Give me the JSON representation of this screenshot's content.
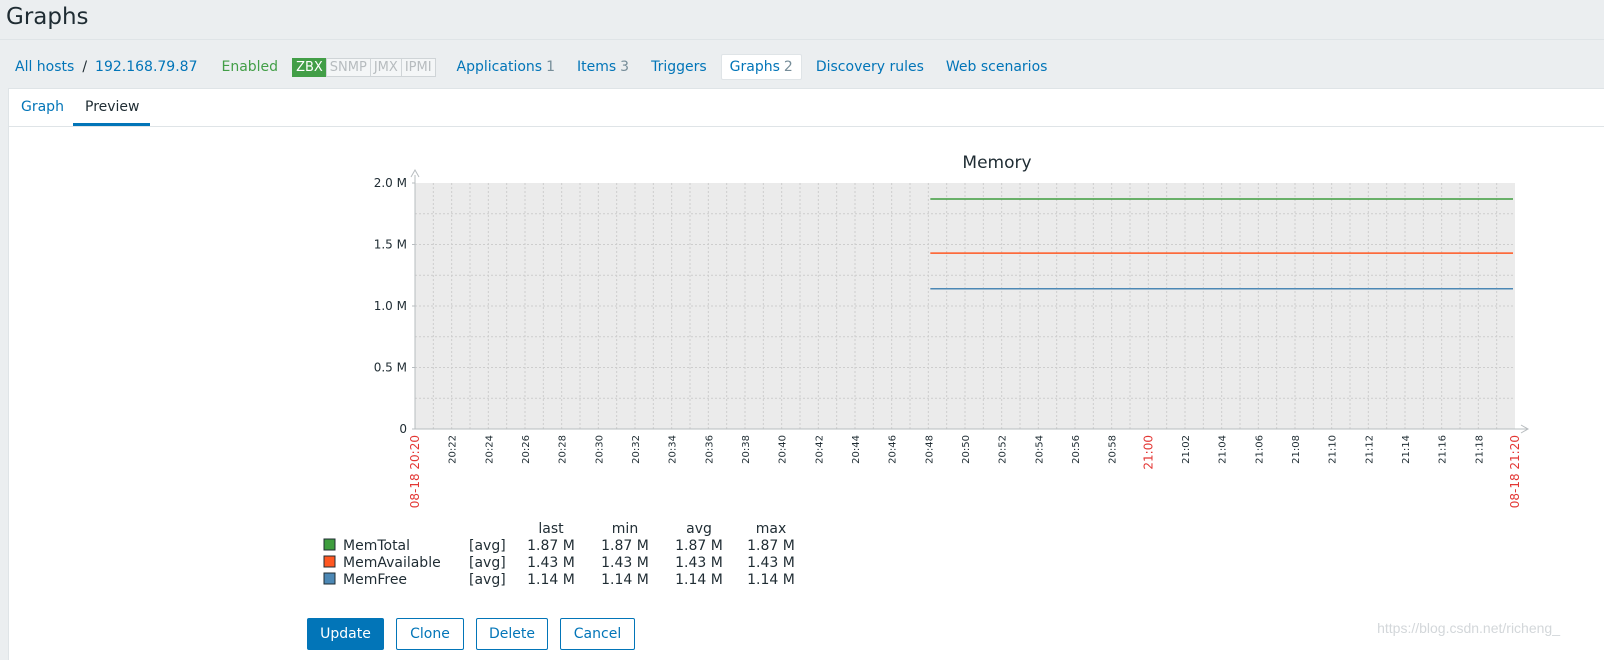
{
  "page": {
    "title": "Graphs"
  },
  "hostnav": {
    "all_hosts": "All hosts",
    "separator": "/",
    "host": "192.168.79.87",
    "status": "Enabled",
    "badges": [
      "ZBX",
      "SNMP",
      "JMX",
      "IPMI"
    ],
    "menu": [
      {
        "label": "Applications",
        "count": "1"
      },
      {
        "label": "Items",
        "count": "3"
      },
      {
        "label": "Triggers",
        "count": ""
      },
      {
        "label": "Graphs",
        "count": "2"
      },
      {
        "label": "Discovery rules",
        "count": ""
      },
      {
        "label": "Web scenarios",
        "count": ""
      }
    ]
  },
  "tabs": [
    "Graph",
    "Preview"
  ],
  "chart_data": {
    "type": "line",
    "title": "Memory",
    "x": [
      "20:20",
      "20:22",
      "20:24",
      "20:26",
      "20:28",
      "20:30",
      "20:32",
      "20:34",
      "20:36",
      "20:38",
      "20:40",
      "20:42",
      "20:44",
      "20:46",
      "20:48",
      "20:50",
      "20:52",
      "20:54",
      "20:56",
      "20:58",
      "21:00",
      "21:02",
      "21:04",
      "21:06",
      "21:08",
      "21:10",
      "21:12",
      "21:14",
      "21:16",
      "21:18",
      "21:20"
    ],
    "x_edge_labels": [
      "08-18 20:20",
      "08-18 21:20"
    ],
    "x_highlight": "21:00",
    "y_ticks": [
      "0",
      "0.5 M",
      "1.0 M",
      "1.5 M",
      "2.0 M"
    ],
    "ylim": [
      0,
      2.0
    ],
    "grid": true,
    "legend_headers": [
      "last",
      "min",
      "avg",
      "max"
    ],
    "series": [
      {
        "name": "MemTotal",
        "func": "[avg]",
        "color": "#3e9d3e",
        "start": "20:48",
        "end": "21:20",
        "value": 1.87,
        "last": "1.87 M",
        "min": "1.87 M",
        "avg": "1.87 M",
        "max": "1.87 M"
      },
      {
        "name": "MemAvailable",
        "func": "[avg]",
        "color": "#ff5722",
        "start": "20:48",
        "end": "21:20",
        "value": 1.43,
        "last": "1.43 M",
        "min": "1.43 M",
        "avg": "1.43 M",
        "max": "1.43 M"
      },
      {
        "name": "MemFree",
        "func": "[avg]",
        "color": "#4c88b5",
        "start": "20:48",
        "end": "21:20",
        "value": 1.14,
        "last": "1.14 M",
        "min": "1.14 M",
        "avg": "1.14 M",
        "max": "1.14 M"
      }
    ]
  },
  "buttons": {
    "update": "Update",
    "clone": "Clone",
    "delete": "Delete",
    "cancel": "Cancel"
  },
  "watermark": "https://blog.csdn.net/richeng_"
}
